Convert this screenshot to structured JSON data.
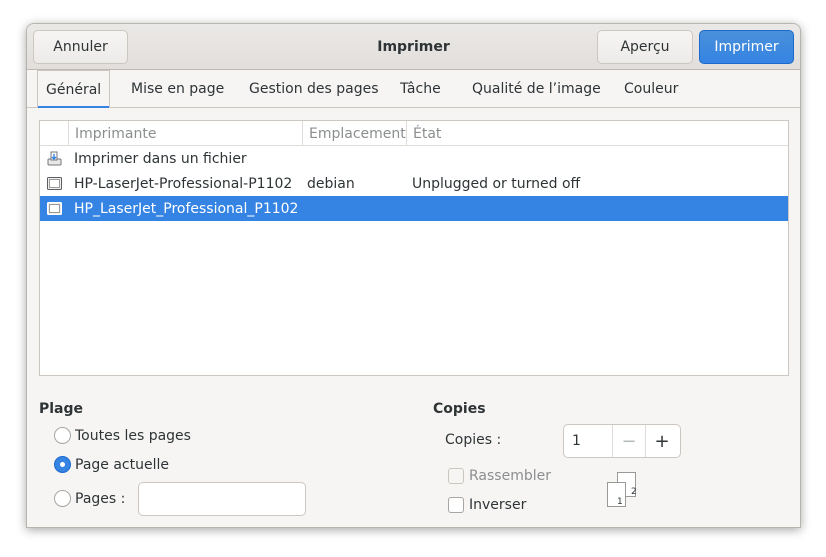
{
  "header": {
    "title": "Imprimer",
    "cancel_label": "Annuler",
    "preview_label": "Aperçu",
    "print_label": "Imprimer"
  },
  "tabs": [
    {
      "label": "Général",
      "active": true
    },
    {
      "label": "Mise en page"
    },
    {
      "label": "Gestion des pages"
    },
    {
      "label": "Tâche"
    },
    {
      "label": "Qualité de l’image"
    },
    {
      "label": "Couleur"
    }
  ],
  "printer_list": {
    "columns": [
      "Imprimante",
      "Emplacement",
      "État"
    ],
    "rows": [
      {
        "icon": "print-to-file-icon",
        "name": "Imprimer dans un fichier",
        "location": "",
        "state": ""
      },
      {
        "icon": "printer-icon",
        "name": "HP-LaserJet-Professional-P1102",
        "location": "debian",
        "state": "Unplugged or turned off"
      },
      {
        "icon": "printer-icon",
        "name": "HP_LaserJet_Professional_P1102",
        "location": "",
        "state": "",
        "selected": true
      }
    ]
  },
  "range": {
    "title": "Plage",
    "all_pages": "Toutes les pages",
    "current_page": "Page actuelle",
    "pages": "Pages :",
    "pages_value": "",
    "selected": "current_page"
  },
  "copies": {
    "title": "Copies",
    "label": "Copies :",
    "value": "1",
    "decrement": "−",
    "increment": "+",
    "collate": "Rassembler",
    "reverse": "Inverser",
    "page_one": "1",
    "page_two": "2"
  },
  "colors": {
    "accent": "#3584e4",
    "bg": "#f6f5f4"
  }
}
